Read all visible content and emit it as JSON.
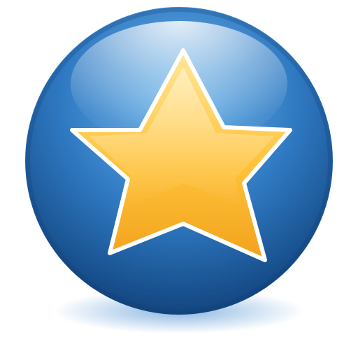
{
  "icon": {
    "name": "favorite-star-icon",
    "shape": "star",
    "style": "glossy blue sphere with gold star"
  },
  "colors": {
    "sphere_light": "#6fb6ea",
    "sphere_mid": "#2f79c2",
    "sphere_dark": "#12457f",
    "star_light": "#ffe89a",
    "star_mid": "#ffc23a",
    "star_dark": "#f2a21c",
    "star_outline": "#ffffff",
    "shadow": "#4b8fd1"
  }
}
